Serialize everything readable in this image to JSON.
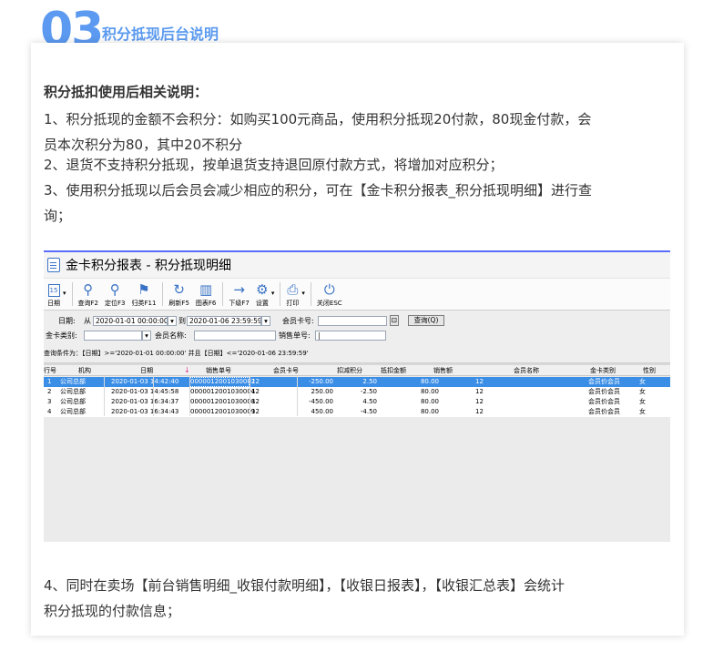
{
  "section": {
    "number": "03",
    "title": "积分抵现后台说明"
  },
  "content": {
    "heading": "积分抵扣使用后相关说明：",
    "line1a": "1、积分抵现的金额不会积分：如购买100元商品，使用积分抵现20付款，80现金付款，会",
    "line1b": "员本次积分为80，其中20不积分",
    "line2": "2、退货不支持积分抵现，按单退货支持退回原付款方式，将增加对应积分；",
    "line3a": "3、使用积分抵现以后会员会减少相应的积分，可在【金卡积分报表_积分抵现明细】进行查",
    "line3b": "询；",
    "line4a": "4、同时在卖场【前台销售明细_收银付款明细】，【收银日报表】，【收银汇总表】会统计",
    "line4b": "积分抵现的付款信息；"
  },
  "app": {
    "window_title": "金卡积分报表 - 积分抵现明细",
    "toolbar": [
      {
        "label": "日期",
        "icon": "calendar-icon",
        "glyph": "15"
      },
      {
        "label": "查询F2",
        "icon": "search-icon",
        "glyph": "⚲"
      },
      {
        "label": "定位F3",
        "icon": "pin-icon",
        "glyph": "⚲"
      },
      {
        "label": "归类F11",
        "icon": "flag-icon",
        "glyph": "⚑"
      },
      {
        "label": "刷新F5",
        "icon": "refresh-icon",
        "glyph": "↻"
      },
      {
        "label": "图表F6",
        "icon": "chart-icon",
        "glyph": "▥"
      },
      {
        "label": "下级F7",
        "icon": "arrow-right-icon",
        "glyph": "→"
      },
      {
        "label": "设置",
        "icon": "gear-icon",
        "glyph": "⚙"
      },
      {
        "label": "打印",
        "icon": "printer-icon",
        "glyph": "⎙"
      },
      {
        "label": "关闭ESC",
        "icon": "power-icon",
        "glyph": "⏻"
      }
    ],
    "filters": {
      "date_label": "日期:",
      "from_label": "从",
      "from_value": "2020-01-01 00:00:00",
      "to_label": "到",
      "to_value": "2020-01-06 23:59:59",
      "member_card_label": "会员卡号:",
      "member_card_value": "",
      "search_button": "查询(Q)",
      "card_type_label": "金卡类别:",
      "card_type_value": "",
      "member_name_label": "会员名称:",
      "member_name_value": "",
      "sale_no_label": "销售单号:",
      "sale_no_value": "|",
      "condition": "查询条件为：【日期】>='2020-01-01 00:00:00' 并且【日期】<='2020-01-06 23:59:59'"
    },
    "table": {
      "columns": [
        "行号",
        "机构",
        "日期",
        "销售单号",
        "会员卡号",
        "扣减积分",
        "抵扣金额",
        "销售额",
        "会员名称",
        "金卡类别",
        "性别"
      ],
      "rows": [
        {
          "no": "1",
          "org": "公司总部",
          "date": "2020-01-03 14:42:40",
          "sale_no": "0000012001030002",
          "card": "12",
          "points": "-250.00",
          "deduct": "2.50",
          "sales": "80.00",
          "sales_extra": "12",
          "name": "",
          "card_type": "会员价会员",
          "gender": "女"
        },
        {
          "no": "2",
          "org": "公司总部",
          "date": "2020-01-03 14:45:58",
          "sale_no": "0000012001030004",
          "card": "12",
          "points": "250.00",
          "deduct": "-2.50",
          "sales": "80.00",
          "sales_extra": "12",
          "name": "",
          "card_type": "会员价会员",
          "gender": "女"
        },
        {
          "no": "3",
          "org": "公司总部",
          "date": "2020-01-03 16:34:37",
          "sale_no": "0000012001030008",
          "card": "12",
          "points": "-450.00",
          "deduct": "4.50",
          "sales": "80.00",
          "sales_extra": "12",
          "name": "",
          "card_type": "会员价会员",
          "gender": "女"
        },
        {
          "no": "4",
          "org": "公司总部",
          "date": "2020-01-03 16:34:43",
          "sale_no": "0000012001030009",
          "card": "12",
          "points": "450.00",
          "deduct": "-4.50",
          "sales": "80.00",
          "sales_extra": "12",
          "name": "",
          "card_type": "会员价会员",
          "gender": "女"
        }
      ]
    }
  },
  "colors": {
    "accent": "#5b9af0",
    "selected_row": "#3b8ee6"
  }
}
